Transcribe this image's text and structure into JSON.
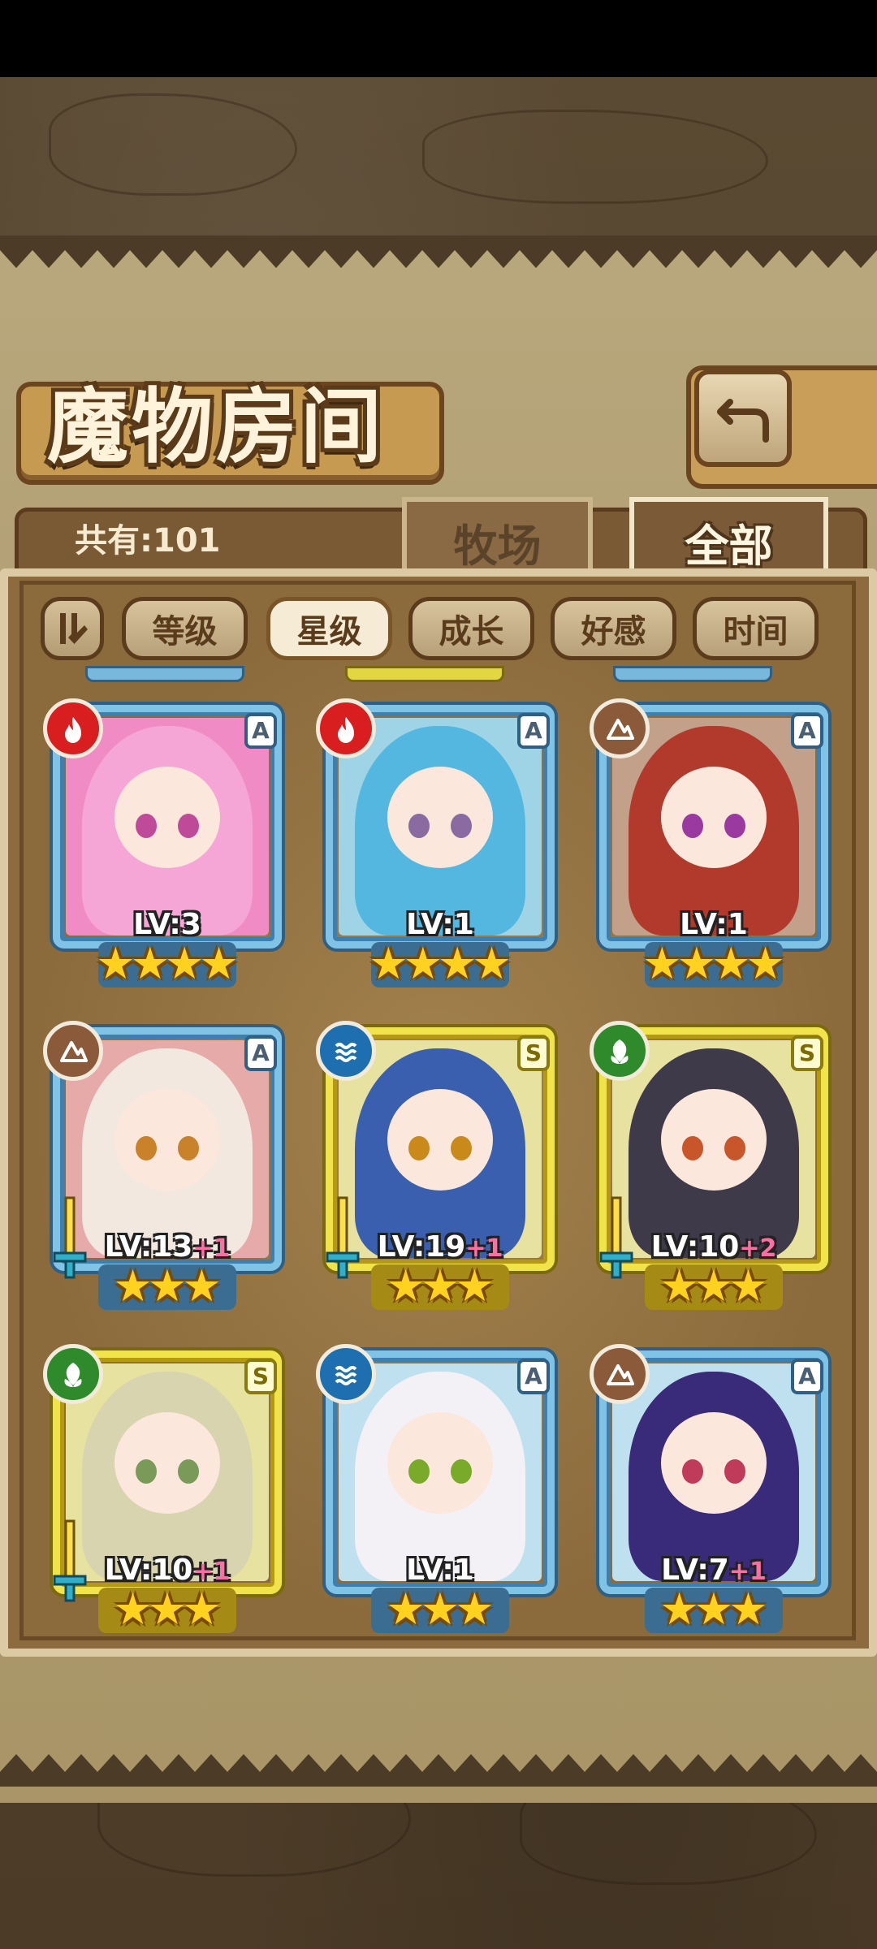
{
  "header": {
    "title": "魔物房间",
    "count_text": "共有:101"
  },
  "tabs": [
    {
      "label": "牧场",
      "active": false
    },
    {
      "label": "全部",
      "active": true
    }
  ],
  "sort_buttons": [
    {
      "label": "等级",
      "active": false
    },
    {
      "label": "星级",
      "active": true
    },
    {
      "label": "成长",
      "active": false
    },
    {
      "label": "好感",
      "active": false
    },
    {
      "label": "时间",
      "active": false
    }
  ],
  "monsters": [
    {
      "level": "LV:3",
      "bonus": "",
      "rank": "A",
      "element": "fire",
      "stars": 4,
      "frame": "blue",
      "sword": false,
      "palette": {
        "bg": "#f08bc6",
        "hair": "#f5a6d6",
        "eye": "#c04a9a"
      }
    },
    {
      "level": "LV:1",
      "bonus": "",
      "rank": "A",
      "element": "fire",
      "stars": 4,
      "frame": "blue",
      "sword": false,
      "palette": {
        "bg": "#9fd3e6",
        "hair": "#53b7e0",
        "eye": "#8a6aa0"
      }
    },
    {
      "level": "LV:1",
      "bonus": "",
      "rank": "A",
      "element": "earth",
      "stars": 4,
      "frame": "blue",
      "sword": false,
      "palette": {
        "bg": "#c2a08a",
        "hair": "#b23a2c",
        "eye": "#9a3aa0"
      }
    },
    {
      "level": "LV:13",
      "bonus": "+1",
      "rank": "A",
      "element": "earth",
      "stars": 3,
      "frame": "blue",
      "sword": true,
      "palette": {
        "bg": "#e6aaa8",
        "hair": "#f2e8df",
        "eye": "#c9822a"
      }
    },
    {
      "level": "LV:19",
      "bonus": "+1",
      "rank": "S",
      "element": "water",
      "stars": 3,
      "frame": "gold",
      "sword": true,
      "palette": {
        "bg": "#e8e2a0",
        "hair": "#3a5fae",
        "eye": "#c98a1a"
      }
    },
    {
      "level": "LV:10",
      "bonus": "+2",
      "rank": "S",
      "element": "wind",
      "stars": 3,
      "frame": "gold",
      "sword": true,
      "palette": {
        "bg": "#e8e2a0",
        "hair": "#3f3a4a",
        "eye": "#c9562a"
      }
    },
    {
      "level": "LV:10",
      "bonus": "+1",
      "rank": "S",
      "element": "wind",
      "stars": 3,
      "frame": "gold",
      "sword": true,
      "palette": {
        "bg": "#e8e2a0",
        "hair": "#d8d4b0",
        "eye": "#7a9a5a"
      }
    },
    {
      "level": "LV:1",
      "bonus": "",
      "rank": "A",
      "element": "water",
      "stars": 3,
      "frame": "blue",
      "sword": false,
      "palette": {
        "bg": "#bfe0ef",
        "hair": "#f3f0f6",
        "eye": "#7aaa2a"
      }
    },
    {
      "level": "LV:7",
      "bonus": "+1",
      "rank": "A",
      "element": "earth",
      "stars": 3,
      "frame": "blue",
      "sword": false,
      "palette": {
        "bg": "#bfe0ef",
        "hair": "#3a2a7a",
        "eye": "#c03a5a"
      }
    }
  ],
  "colors": {
    "fire": "#d81e1e",
    "water": "#1e6fb0",
    "wind": "#2e8a2a",
    "earth": "#8a5a3a"
  }
}
